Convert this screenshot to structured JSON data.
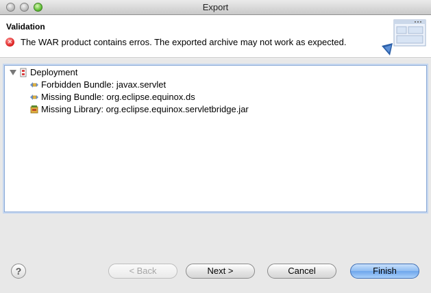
{
  "window": {
    "title": "Export"
  },
  "header": {
    "title": "Validation",
    "message": "The WAR product contains erros. The exported archive may not work as expected.",
    "message_icon": "error-icon",
    "banner_icon": "export-wizard-banner"
  },
  "tree": {
    "root": {
      "label": "Deployment",
      "icon": "product-icon",
      "expanded": true
    },
    "children": [
      {
        "label": "Forbidden Bundle: javax.servlet",
        "icon": "plugin-icon"
      },
      {
        "label": "Missing Bundle: org.eclipse.equinox.ds",
        "icon": "plugin-icon"
      },
      {
        "label": "Missing Library: org.eclipse.equinox.servletbridge.jar",
        "icon": "jar-icon"
      }
    ]
  },
  "buttons": {
    "help": "?",
    "back": "< Back",
    "next": "Next >",
    "cancel": "Cancel",
    "finish": "Finish"
  },
  "colors": {
    "accent": "#6ea6ec",
    "error": "#d22222"
  }
}
